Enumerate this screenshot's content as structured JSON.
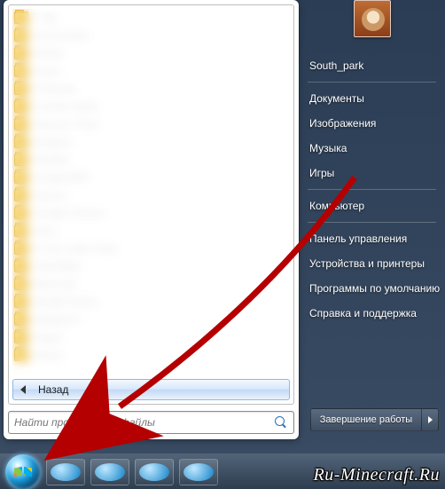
{
  "start_menu": {
    "back_label": "Назад",
    "search_placeholder": "Найти программы и файлы",
    "programs": [
      "7-Zip",
      "Accessories",
      "Adobe",
      "Avast",
      "CCleaner",
      "Counter-Strike",
      "Daemon Tools",
      "Dropbox",
      "FileZilla",
      "Foobar2000",
      "Games",
      "Google Chrome",
      "Java",
      "K-Lite Codec Pack",
      "LibreOffice",
      "Minecraft",
      "Mozilla Firefox",
      "Notepad++",
      "Skype",
      "Steam"
    ]
  },
  "right_panel": {
    "username": "South_park",
    "items_top": [
      "Документы",
      "Изображения",
      "Музыка",
      "Игры"
    ],
    "items_mid": [
      "Компьютер"
    ],
    "items_bot": [
      "Панель управления",
      "Устройства и принтеры",
      "Программы по умолчанию",
      "Справка и поддержка"
    ]
  },
  "shutdown": {
    "label": "Завершение работы"
  },
  "watermark": "Ru-Minecraft.Ru"
}
